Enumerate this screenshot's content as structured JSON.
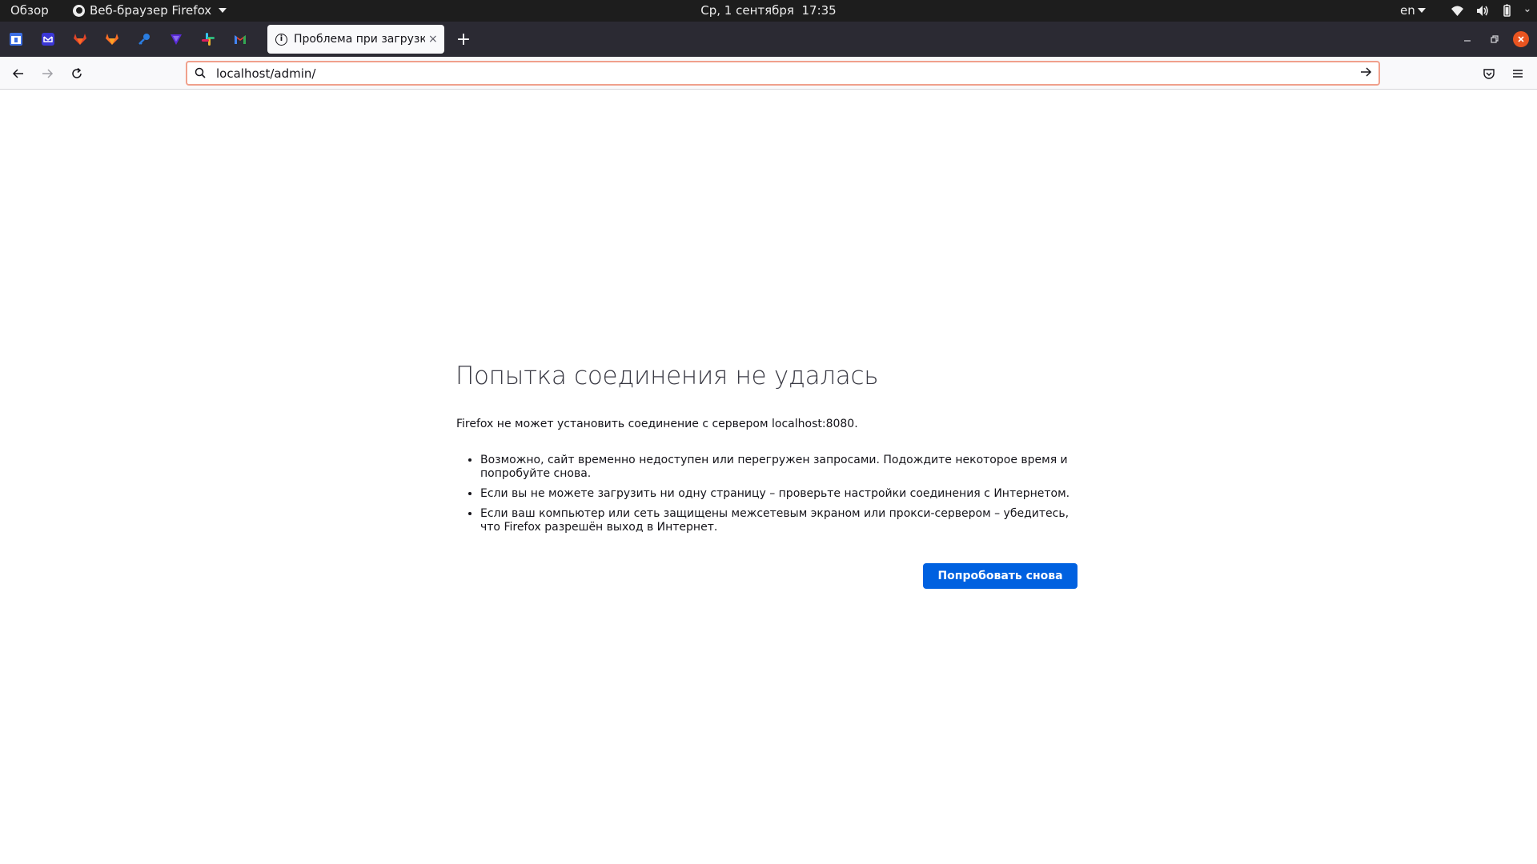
{
  "topbar": {
    "overview": "Обзор",
    "app_name": "Веб-браузер Firefox",
    "clock": "Ср, 1 сентября  17:35",
    "language": "en"
  },
  "pinned_tabs": [
    {
      "icon": "calendar-icon",
      "color": "#3d6fe3"
    },
    {
      "icon": "mail-icon",
      "color": "#3b37d6"
    },
    {
      "icon": "gitlab-icon",
      "color": "#e24329"
    },
    {
      "icon": "gitlab-icon",
      "color": "#fc6d26"
    },
    {
      "icon": "key-icon",
      "color": "#2a7de1"
    },
    {
      "icon": "shield-icon",
      "color": "#5a2bd8"
    },
    {
      "icon": "slack-icon",
      "color": "#e01e5a"
    },
    {
      "icon": "gmail-icon",
      "color": "#ea4335"
    }
  ],
  "active_tab": {
    "title": "Проблема при загрузке страницы",
    "close": "×"
  },
  "newtab_label": "+",
  "urlbar": {
    "value": "localhost/admin/"
  },
  "error_page": {
    "title": "Попытка соединения не удалась",
    "description": "Firefox не может установить соединение с сервером localhost:8080.",
    "items": [
      "Возможно, сайт временно недоступен или перегружен запросами. Подождите некоторое время и попробуйте снова.",
      "Если вы не можете загрузить ни одну страницу – проверьте настройки соединения с Интернетом.",
      "Если ваш компьютер или сеть защищены межсетевым экраном или прокси-сервером – убедитесь, что Firefox разрешён выход в Интернет."
    ],
    "retry_button": "Попробовать снова"
  },
  "colors": {
    "accent": "#0061e0",
    "close_button": "#e95420",
    "urlbar_focus_border": "#f0a08c"
  }
}
